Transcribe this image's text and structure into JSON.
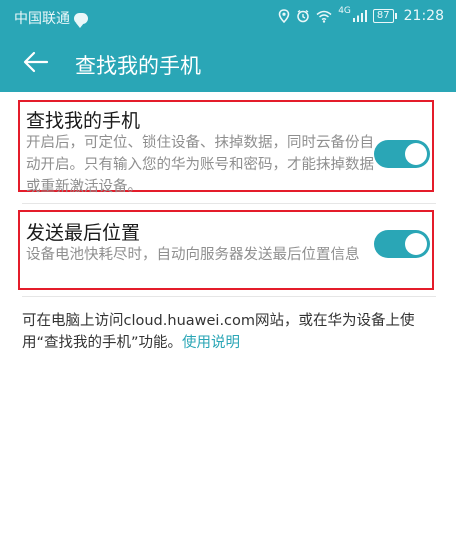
{
  "status_bar": {
    "carrier": "中国联通",
    "signal_label": "4G",
    "battery": "87",
    "time": "21:28"
  },
  "toolbar": {
    "title": "查找我的手机"
  },
  "settings": [
    {
      "title": "查找我的手机",
      "description": "开启后，可定位、锁住设备、抹掉数据，同时云备份自动开启。只有输入您的华为账号和密码，才能抹掉数据或重新激活设备。",
      "enabled": true
    },
    {
      "title": "发送最后位置",
      "description": "设备电池快耗尽时，自动向服务器发送最后位置信息",
      "enabled": true
    }
  ],
  "footer": {
    "text": "可在电脑上访问cloud.huawei.com网站，或在华为设备上使用“查找我的手机”功能。",
    "link": "使用说明"
  },
  "colors": {
    "accent": "#2aa6b6",
    "highlight_border": "#e41c2a"
  }
}
